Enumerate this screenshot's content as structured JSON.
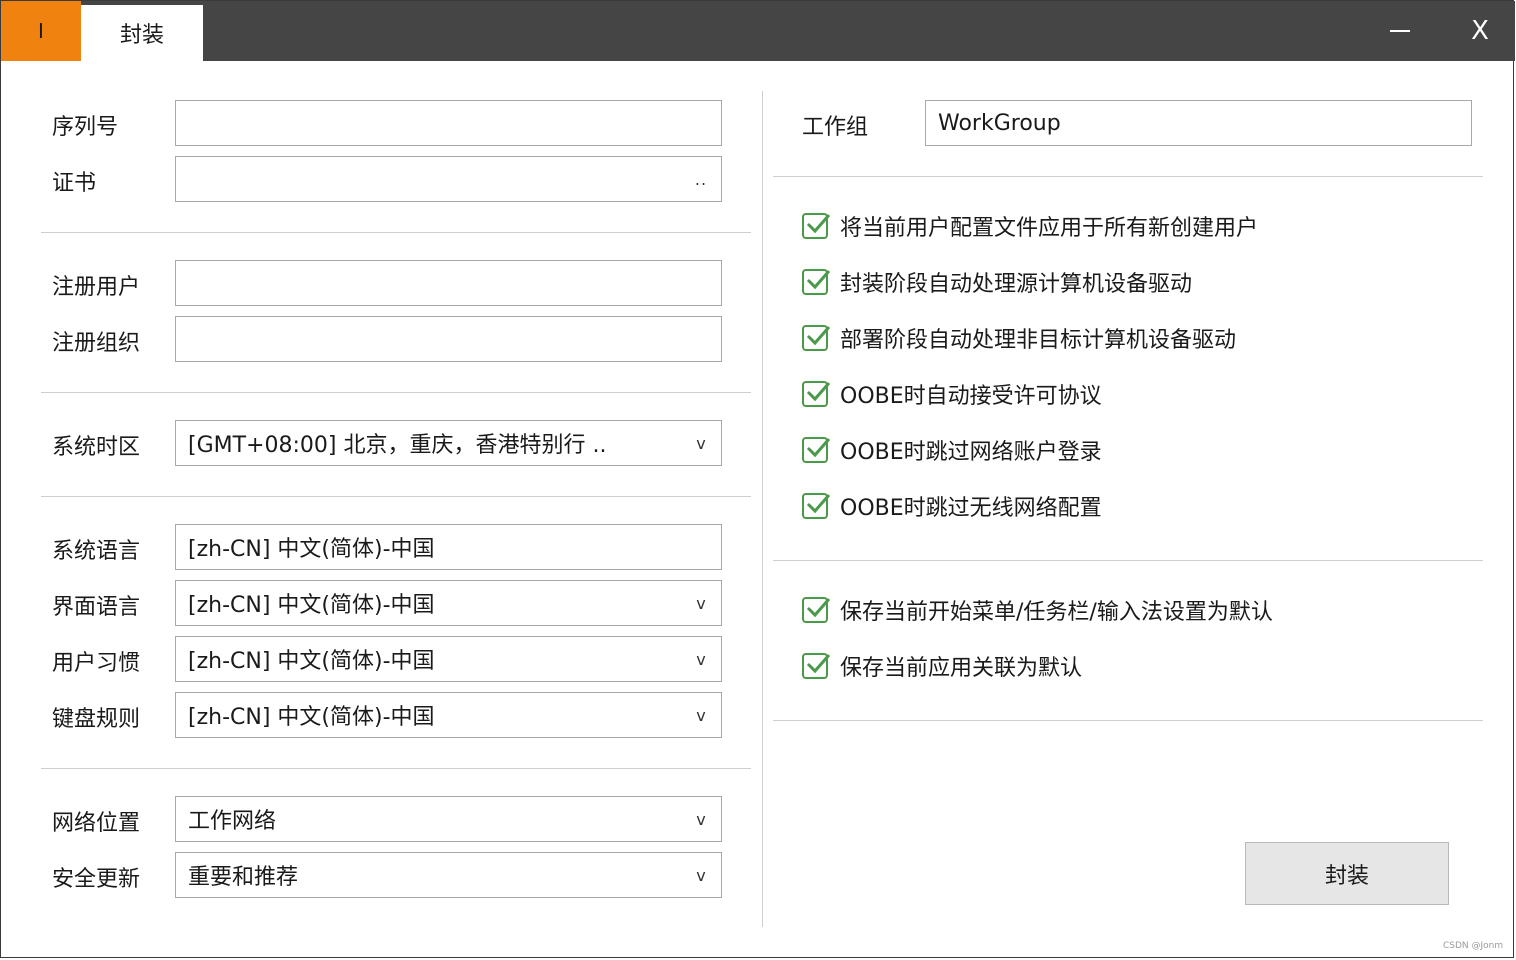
{
  "titlebar": {
    "app_icon_text": "I",
    "tab_title": "封装",
    "minimize_icon": "minimize-icon",
    "close_label": "X"
  },
  "left": {
    "serial": {
      "label": "序列号",
      "value": ""
    },
    "certificate": {
      "label": "证书",
      "value": "",
      "browse_label": ".."
    },
    "reg_user": {
      "label": "注册用户",
      "value": ""
    },
    "reg_org": {
      "label": "注册组织",
      "value": ""
    },
    "timezone": {
      "label": "系统时区",
      "value": "[GMT+08:00] 北京，重庆，香港特别行 ..",
      "chevron": "v"
    },
    "system_language": {
      "label": "系统语言",
      "value": "[zh-CN] 中文(简体)-中国"
    },
    "ui_language": {
      "label": "界面语言",
      "value": "[zh-CN] 中文(简体)-中国",
      "chevron": "v"
    },
    "user_locale": {
      "label": "用户习惯",
      "value": "[zh-CN] 中文(简体)-中国",
      "chevron": "v"
    },
    "keyboard": {
      "label": "键盘规则",
      "value": "[zh-CN] 中文(简体)-中国",
      "chevron": "v"
    },
    "network_location": {
      "label": "网络位置",
      "value": "工作网络",
      "chevron": "v"
    },
    "security_update": {
      "label": "安全更新",
      "value": "重要和推荐",
      "chevron": "v"
    }
  },
  "right": {
    "workgroup": {
      "label": "工作组",
      "value": "WorkGroup"
    },
    "options_group1": [
      {
        "label": "将当前用户配置文件应用于所有新创建用户",
        "checked": true
      },
      {
        "label": "封装阶段自动处理源计算机设备驱动",
        "checked": true
      },
      {
        "label": "部署阶段自动处理非目标计算机设备驱动",
        "checked": true
      },
      {
        "label": "OOBE时自动接受许可协议",
        "checked": true
      },
      {
        "label": "OOBE时跳过网络账户登录",
        "checked": true
      },
      {
        "label": "OOBE时跳过无线网络配置",
        "checked": true
      }
    ],
    "options_group2": [
      {
        "label": "保存当前开始菜单/任务栏/输入法设置为默认",
        "checked": true
      },
      {
        "label": "保存当前应用关联为默认",
        "checked": true
      }
    ],
    "seal_button": "封装"
  },
  "watermark": "CSDN @Jonm",
  "colors": {
    "titlebar": "#454545",
    "app_icon_bg": "#f0820f",
    "checkbox": "#4a9a4a"
  }
}
